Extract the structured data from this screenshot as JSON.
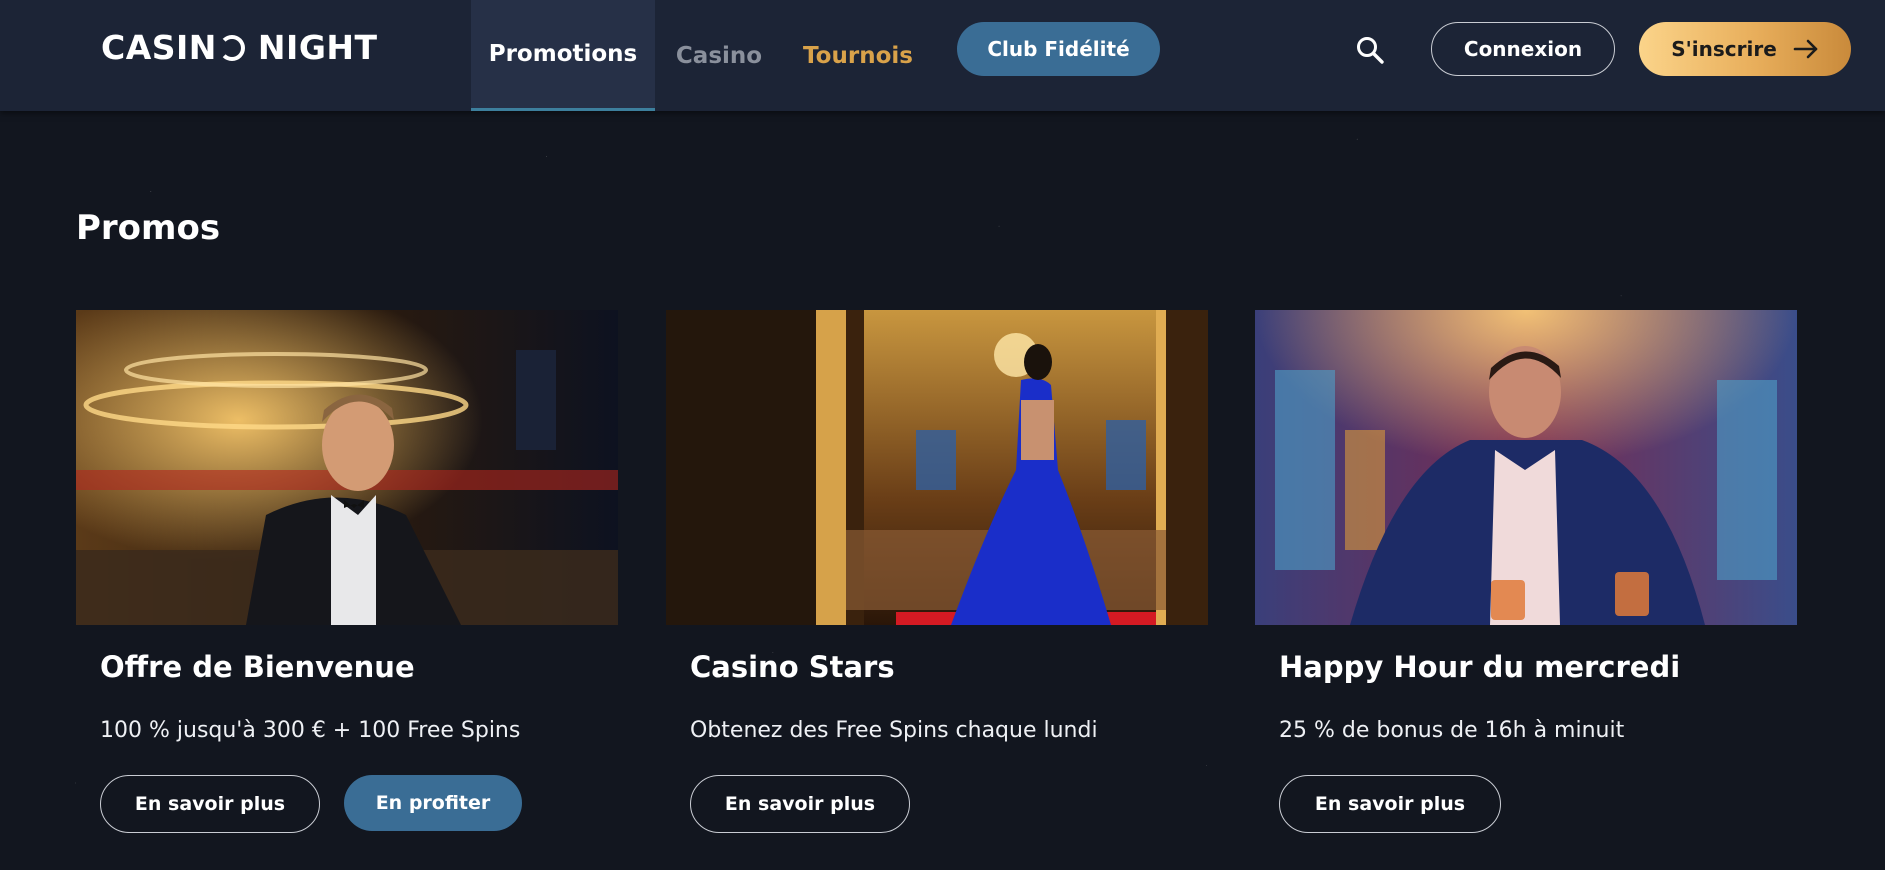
{
  "header": {
    "logo": {
      "part1": "CASIN",
      "part2": "NIGHT"
    },
    "nav": {
      "promotions": "Promotions",
      "casino": "Casino",
      "tournois": "Tournois"
    },
    "club_button": "Club Fidélité",
    "login_button": "Connexion",
    "signup_button": "S'inscrire"
  },
  "main": {
    "title": "Promos",
    "cards": [
      {
        "title": "Offre de Bienvenue",
        "description": "100 % jusqu'à 300 € + 100 Free Spins",
        "more_button": "En savoir plus",
        "claim_button": "En profiter"
      },
      {
        "title": "Casino Stars",
        "description": "Obtenez des Free Spins chaque lundi",
        "more_button": "En savoir plus"
      },
      {
        "title": "Happy Hour du mercredi",
        "description": "25 % de bonus de 16h à minuit",
        "more_button": "En savoir plus"
      }
    ]
  },
  "colors": {
    "header_bg": "#1c2436",
    "page_bg": "#12161f",
    "accent_blue": "#3a6d95",
    "accent_gold": "#d9a24a",
    "signup_gradient_start": "#fbd48a",
    "signup_gradient_end": "#c98a3b"
  },
  "icons": {
    "search": "search-icon",
    "arrow": "arrow-right-icon",
    "logo_moon": "crescent-moon-icon"
  }
}
